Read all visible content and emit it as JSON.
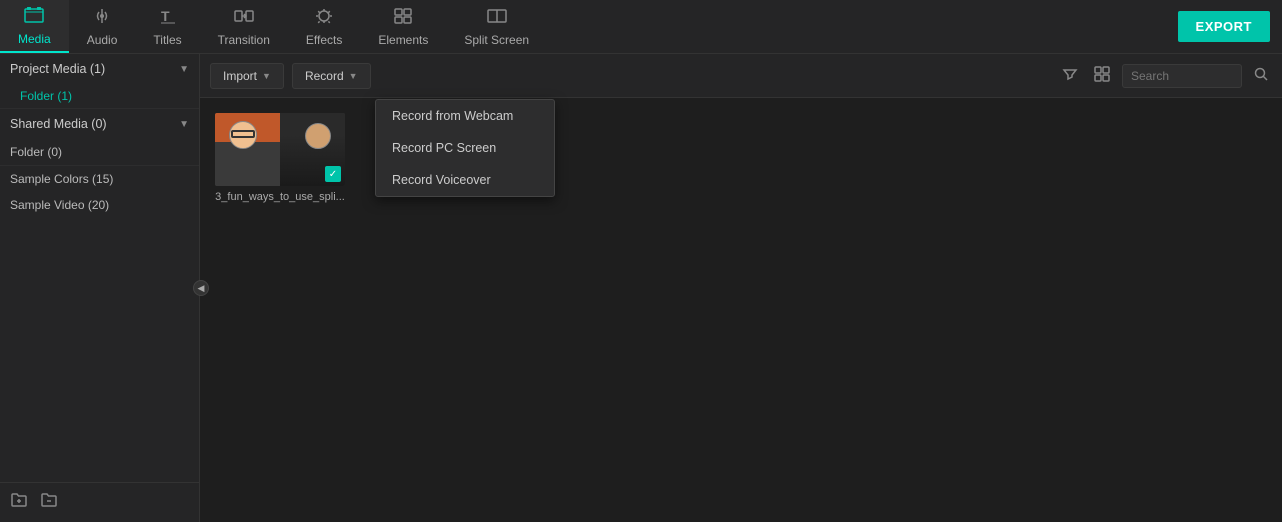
{
  "nav": {
    "items": [
      {
        "id": "media",
        "label": "Media",
        "icon": "🗂",
        "active": true
      },
      {
        "id": "audio",
        "label": "Audio",
        "icon": "♪"
      },
      {
        "id": "titles",
        "label": "Titles",
        "icon": "T"
      },
      {
        "id": "transition",
        "label": "Transition",
        "icon": "⇆"
      },
      {
        "id": "effects",
        "label": "Effects",
        "icon": "✦"
      },
      {
        "id": "elements",
        "label": "Elements",
        "icon": "⊞"
      },
      {
        "id": "splitscreen",
        "label": "Split Screen",
        "icon": "▣"
      }
    ],
    "export_label": "EXPORT"
  },
  "sidebar": {
    "project_media": "Project Media (1)",
    "folder_1": "Folder (1)",
    "shared_media": "Shared Media (0)",
    "folder_0": "Folder (0)",
    "sample_colors": "Sample Colors (15)",
    "sample_video": "Sample Video (20)"
  },
  "toolbar": {
    "import_label": "Import",
    "record_label": "Record",
    "search_placeholder": "Search"
  },
  "record_dropdown": {
    "items": [
      "Record from Webcam",
      "Record PC Screen",
      "Record Voiceover"
    ]
  },
  "media_item": {
    "label": "3_fun_ways_to_use_spli..."
  }
}
